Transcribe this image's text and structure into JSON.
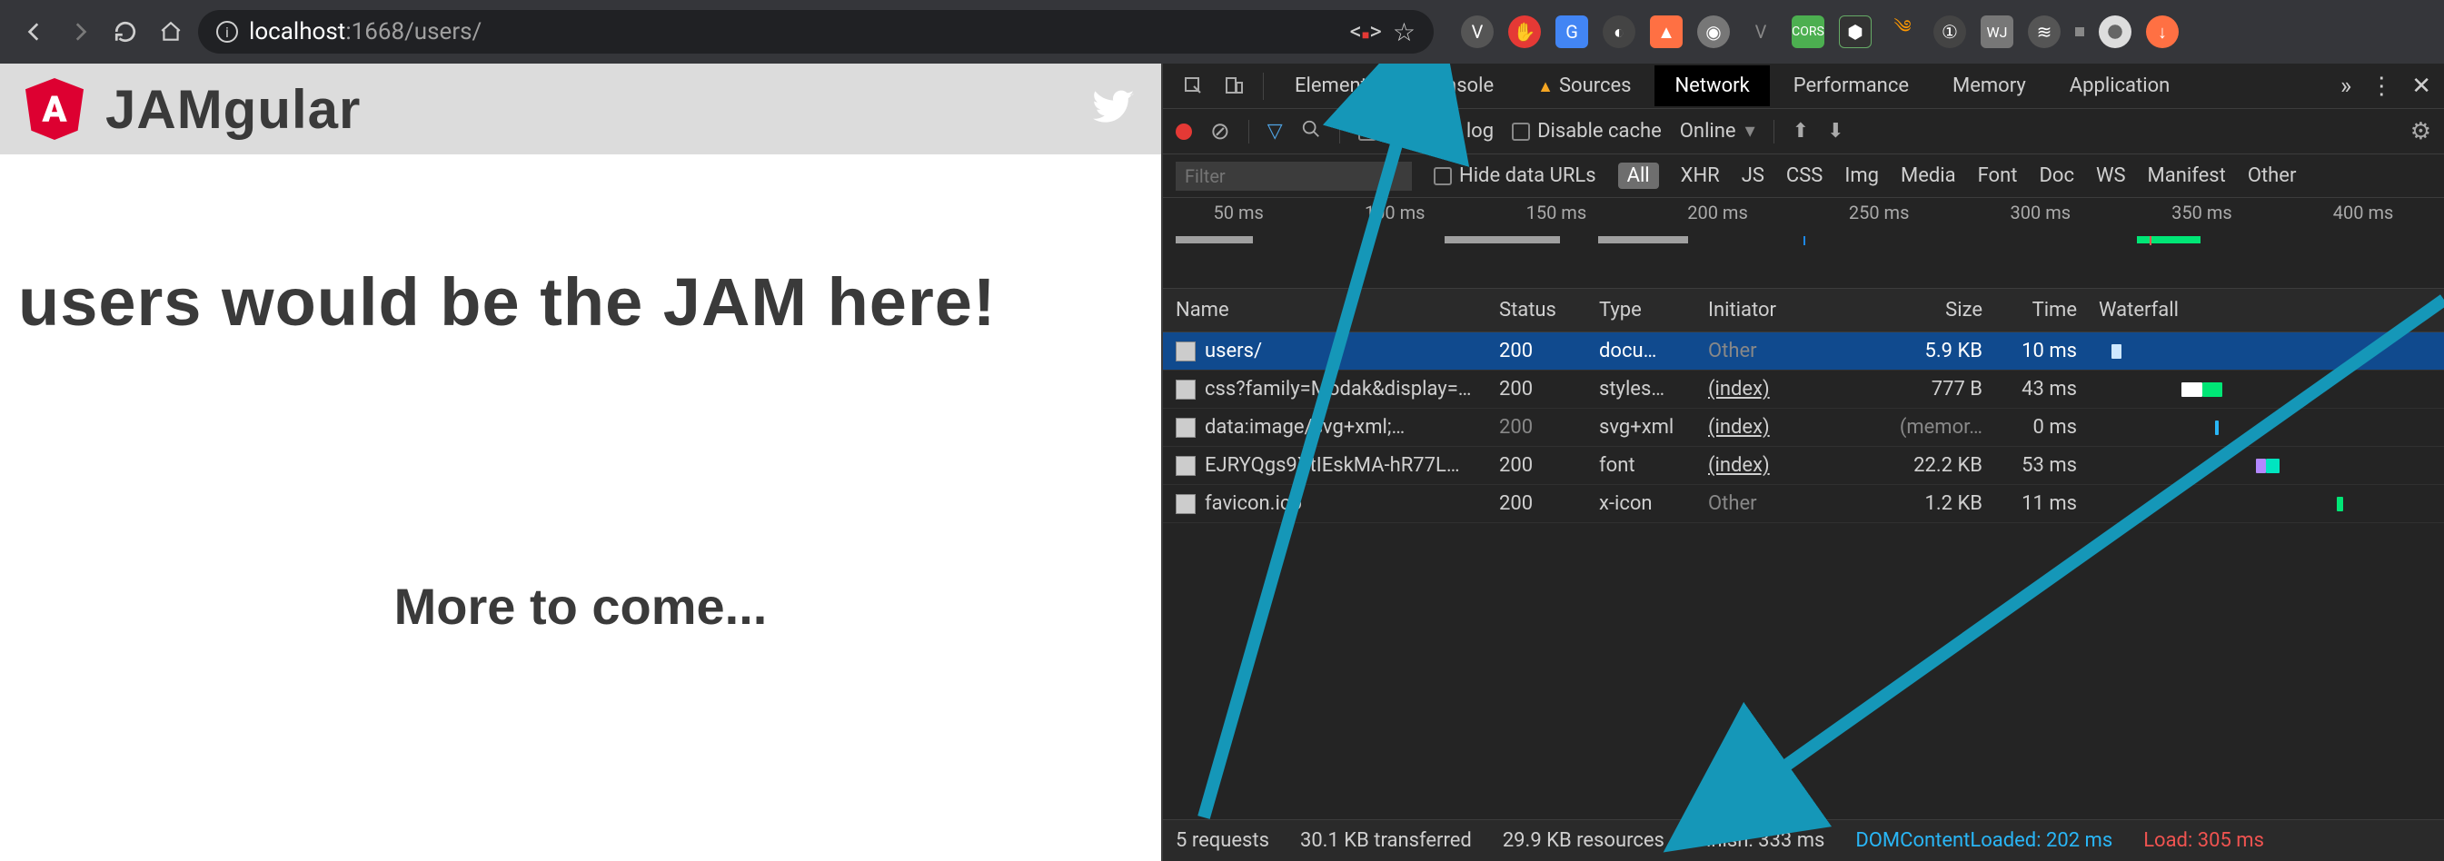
{
  "browser": {
    "url_info_icon": "ⓘ",
    "url_host": "localhost",
    "url_port": ":1668",
    "url_path": "/users/",
    "extensions": [
      "dev",
      "stop",
      "gtrans",
      "circ",
      "a",
      "disc",
      "vue",
      "cors",
      "node",
      "rss",
      "1p",
      "wj",
      "stack",
      "avatar",
      "down"
    ]
  },
  "page": {
    "brand": "JAMgular",
    "headline": "users would be the JAM here!",
    "subline": "More to come..."
  },
  "devtools": {
    "tabs": [
      "Elements",
      "Console",
      "Sources",
      "Network",
      "Performance",
      "Memory",
      "Application"
    ],
    "active_tab": "Network",
    "toolbar": {
      "preserve": "Preserve log",
      "disable_cache": "Disable cache",
      "online": "Online"
    },
    "filterbar": {
      "placeholder": "Filter",
      "hide_data": "Hide data URLs",
      "types": [
        "All",
        "XHR",
        "JS",
        "CSS",
        "Img",
        "Media",
        "Font",
        "Doc",
        "WS",
        "Manifest",
        "Other"
      ]
    },
    "timeline_ticks": [
      "50 ms",
      "100 ms",
      "150 ms",
      "200 ms",
      "250 ms",
      "300 ms",
      "350 ms",
      "400 ms"
    ],
    "columns": [
      "Name",
      "Status",
      "Type",
      "Initiator",
      "Size",
      "Time",
      "Waterfall"
    ],
    "rows": [
      {
        "name": "users/",
        "status": "200",
        "type": "docu…",
        "initiator": "Other",
        "init_link": false,
        "size": "5.9 KB",
        "time": "10 ms",
        "sel": true,
        "wf": [
          {
            "l": 1,
            "w": 3,
            "c": "#cfe8ff"
          }
        ]
      },
      {
        "name": "css?family=Modak&display=…",
        "status": "200",
        "type": "styles…",
        "initiator": "(index)",
        "init_link": true,
        "size": "777 B",
        "time": "43 ms",
        "wf": [
          {
            "l": 22,
            "w": 6,
            "c": "#ffffff"
          },
          {
            "l": 28,
            "w": 6,
            "c": "#00e676"
          }
        ]
      },
      {
        "name": "data:image/svg+xml;…",
        "status": "200",
        "status_dim": true,
        "type": "svg+xml",
        "initiator": "(index)",
        "init_link": true,
        "size": "(memor…",
        "size_dim": true,
        "time": "0 ms",
        "wf": [
          {
            "l": 32,
            "w": 1,
            "c": "#29b6f6"
          }
        ]
      },
      {
        "name": "EJRYQgs9XtIEskMA-hR77L…",
        "status": "200",
        "type": "font",
        "initiator": "(index)",
        "init_link": true,
        "size": "22.2 KB",
        "time": "53 ms",
        "wf": [
          {
            "l": 44,
            "w": 3,
            "c": "#b388ff"
          },
          {
            "l": 47,
            "w": 4,
            "c": "#00e5c0"
          }
        ]
      },
      {
        "name": "favicon.ico",
        "status": "200",
        "type": "x-icon",
        "initiator": "Other",
        "init_link": false,
        "size": "1.2 KB",
        "time": "11 ms",
        "wf": [
          {
            "l": 68,
            "w": 2,
            "c": "#00e676"
          }
        ]
      }
    ],
    "status": {
      "requests": "5 requests",
      "transferred": "30.1 KB transferred",
      "resources": "29.9 KB resources",
      "finish": "Finish: 333 ms",
      "dcl": "DOMContentLoaded: 202 ms",
      "load": "Load: 305 ms"
    }
  }
}
